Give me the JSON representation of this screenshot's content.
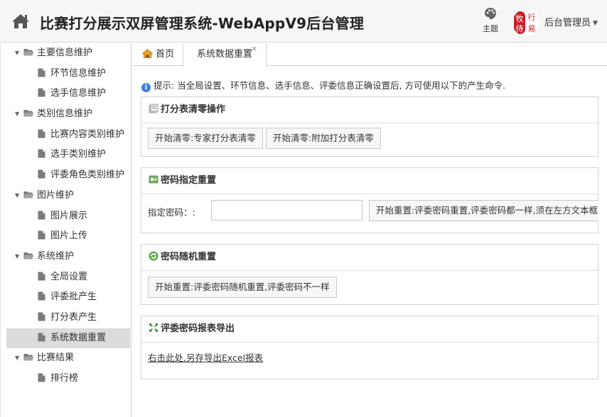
{
  "header": {
    "title": "比赛打分展示双屏管理系统-WebAppV9后台管理",
    "theme_label": "主题",
    "avatar_text": "牧行侍易",
    "admin_label": "后台管理员"
  },
  "sidebar": {
    "groups": [
      {
        "label": "主要信息维护",
        "items": [
          "环节信息维护",
          "选手信息维护"
        ]
      },
      {
        "label": "类别信息维护",
        "items": [
          "比赛内容类别维护",
          "选手类别维护",
          "评委角色类别维护"
        ]
      },
      {
        "label": "图片维护",
        "items": [
          "图片展示",
          "图片上传"
        ]
      },
      {
        "label": "系统维护",
        "items": [
          "全局设置",
          "评委批产生",
          "打分表产生",
          "系统数据重置"
        ]
      },
      {
        "label": "比赛结果",
        "items": [
          "排行榜"
        ]
      }
    ],
    "active_item": "系统数据重置"
  },
  "tabs": {
    "home": "首页",
    "active": "系统数据重置",
    "close_glyph": "×"
  },
  "hint": "提示: 当全局设置、环节信息、选手信息、评委信息正确设置后, 方可使用以下的产生命令.",
  "panels": {
    "clear": {
      "title": "打分表清零操作",
      "btn_expert": "开始清零:专家打分表清零",
      "btn_extra": "开始清零:附加打分表清零"
    },
    "pwd_set": {
      "title": "密码指定重置",
      "label": "指定密码：:",
      "input_value": "",
      "btn": "开始重置:评委密码重置,评委密码都一样,须在左方文本框"
    },
    "pwd_random": {
      "title": "密码随机重置",
      "btn": "开始重置:评委密码随机重置,评委密码不一样"
    },
    "export": {
      "title": "评委密码报表导出",
      "link": "右击此处,另存导出Excel报表"
    }
  },
  "colors": {
    "accent_red": "#c8202a",
    "info_blue": "#3a7fd5",
    "active_bg": "#dcdcdc"
  }
}
